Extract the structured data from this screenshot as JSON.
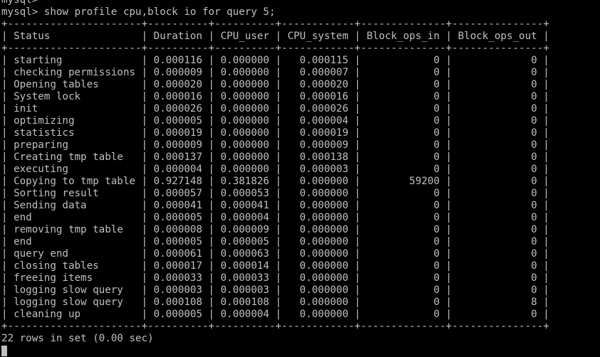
{
  "terminal": {
    "prev_prompt": "mysql>",
    "command_line": "mysql> show profile cpu,block io for query 5;",
    "border": "+----------------------+----------+----------+------------+--------------+---------------+",
    "header": "| Status               | Duration | CPU_user | CPU_system | Block_ops_in | Block_ops_out |",
    "rows": [
      "| starting             | 0.000116 | 0.000000 |   0.000115 |            0 |             0 |",
      "| checking permissions | 0.000009 | 0.000000 |   0.000007 |            0 |             0 |",
      "| Opening tables       | 0.000020 | 0.000000 |   0.000020 |            0 |             0 |",
      "| System lock          | 0.000016 | 0.000000 |   0.000016 |            0 |             0 |",
      "| init                 | 0.000026 | 0.000000 |   0.000026 |            0 |             0 |",
      "| optimizing           | 0.000005 | 0.000000 |   0.000004 |            0 |             0 |",
      "| statistics           | 0.000019 | 0.000000 |   0.000019 |            0 |             0 |",
      "| preparing            | 0.000009 | 0.000000 |   0.000009 |            0 |             0 |",
      "| Creating tmp table   | 0.000137 | 0.000000 |   0.000138 |            0 |             0 |",
      "| executing            | 0.000004 | 0.000000 |   0.000003 |            0 |             0 |",
      "| Copying to tmp table | 0.927148 | 0.381826 |   0.000000 |        59200 |             0 |",
      "| Sorting result       | 0.000057 | 0.000053 |   0.000000 |            0 |             0 |",
      "| Sending data         | 0.000041 | 0.000041 |   0.000000 |            0 |             0 |",
      "| end                  | 0.000005 | 0.000004 |   0.000000 |            0 |             0 |",
      "| removing tmp table   | 0.000008 | 0.000009 |   0.000000 |            0 |             0 |",
      "| end                  | 0.000005 | 0.000005 |   0.000000 |            0 |             0 |",
      "| query end            | 0.000061 | 0.000063 |   0.000000 |            0 |             0 |",
      "| closing tables       | 0.000017 | 0.000014 |   0.000000 |            0 |             0 |",
      "| freeing items        | 0.000033 | 0.000033 |   0.000000 |            0 |             0 |",
      "| logging slow query   | 0.000003 | 0.000003 |   0.000000 |            0 |             0 |",
      "| logging slow query   | 0.000108 | 0.000108 |   0.000000 |            0 |             8 |",
      "| cleaning up          | 0.000005 | 0.000004 |   0.000000 |            0 |             0 |"
    ],
    "summary": "22 rows in set (0.00 sec)",
    "colors": {
      "background": "#000000",
      "text": "#c0c0c0"
    }
  }
}
